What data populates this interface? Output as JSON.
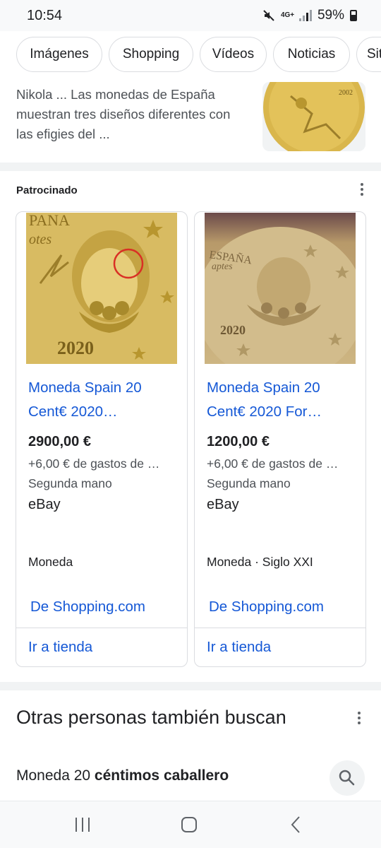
{
  "status_bar": {
    "time": "10:54",
    "network": "4G+",
    "battery": "59%",
    "icons": [
      "mute-icon",
      "network-icon",
      "signal-icon",
      "battery-icon"
    ]
  },
  "chips": [
    "Imágenes",
    "Shopping",
    "Vídeos",
    "Noticias",
    "Sit"
  ],
  "snippet": {
    "lines": [
      "Nikola ... Las monedas de España",
      "muestran tres diseños diferentes con",
      "las efigies del ..."
    ],
    "thumbnail_text": "2002"
  },
  "sponsored": {
    "label": "Patrocinado",
    "cards": [
      {
        "title_line1": "Moneda Spain 20",
        "title_line2": "Cent€ 2020…",
        "price": "2900,00 €",
        "shipping": "+6,00 € de gastos de …",
        "condition": "Segunda mano",
        "store": "eBay",
        "category": "Moneda",
        "source": "De Shopping.com",
        "action": "Ir a tienda",
        "coin_text": "2020"
      },
      {
        "title_line1": "Moneda Spain 20",
        "title_line2": "Cent€ 2020 For…",
        "price": "1200,00 €",
        "shipping": "+6,00 € de gastos de …",
        "condition": "Segunda mano",
        "store": "eBay",
        "category": "Moneda · Siglo XXI",
        "source": "De Shopping.com",
        "action": "Ir a tienda",
        "coin_text": "2020"
      }
    ]
  },
  "related": {
    "title": "Otras personas también buscan",
    "item_prefix": "Moneda 20 ",
    "item_bold": "céntimos caballero"
  },
  "colors": {
    "link": "#1558d6",
    "coin_gold": "#c9a94e",
    "highlight_circle": "#d93025"
  }
}
